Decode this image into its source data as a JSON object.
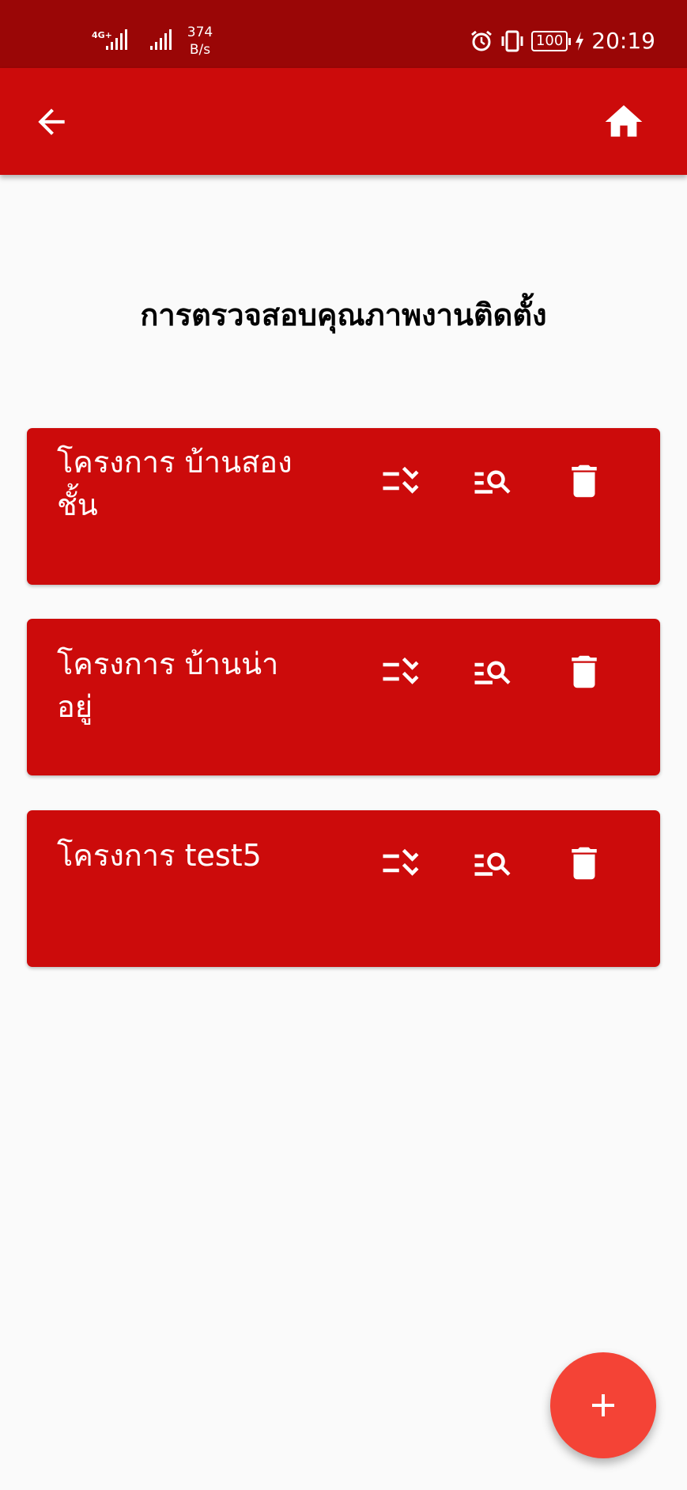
{
  "status_bar": {
    "net_speed_value": "374",
    "net_speed_unit": "B/s",
    "battery": "100",
    "time": "20:19"
  },
  "app_bar": {
    "back_icon": "arrow-back-icon",
    "home_icon": "home-icon",
    "color": "#cc0b0b"
  },
  "page": {
    "title": "การตรวจสอบคุณภาพงานติดตั้ง"
  },
  "projects": [
    {
      "label": "โครงการ บ้านสอง ชั้น"
    },
    {
      "label": "โครงการ บ้านน่าอยู่"
    },
    {
      "label": "โครงการ test5"
    }
  ],
  "actions": {
    "check_icon": "checklist-icon",
    "search_icon": "list-search-icon",
    "delete_icon": "trash-icon"
  },
  "fab": {
    "icon": "plus-icon",
    "color": "#f44336"
  }
}
